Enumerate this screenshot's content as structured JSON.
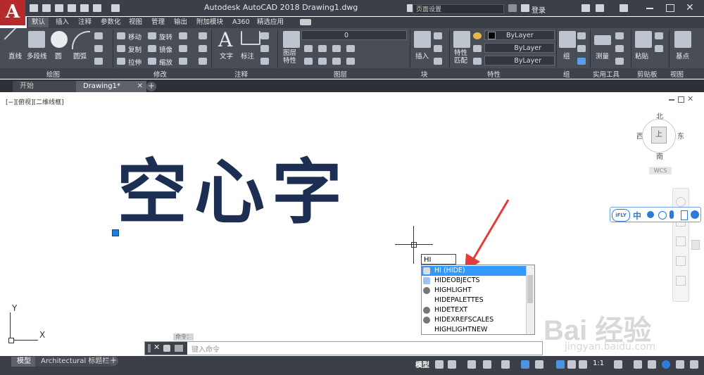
{
  "app": {
    "logo_letter": "A",
    "title": "Autodesk AutoCAD 2018    Drawing1.dwg",
    "search_placeholder": "页面设置",
    "login": "登录"
  },
  "ribbon_tabs": [
    "默认",
    "插入",
    "注释",
    "参数化",
    "视图",
    "管理",
    "输出",
    "附加模块",
    "A360",
    "精选应用"
  ],
  "ribbon": {
    "draw": {
      "line": "直线",
      "polyline": "多段线",
      "circle": "圆",
      "arc": "圆弧"
    },
    "modify": {
      "move": "移动",
      "rotate": "旋转",
      "copy": "复制",
      "mirror": "镜像",
      "stretch": "拉伸",
      "scale": "缩放"
    },
    "annotation": {
      "text": "文字",
      "dimension": "标注"
    },
    "layers": {
      "layer_props": "图层\n特性",
      "current_layer": "0"
    },
    "block": {
      "insert": "插入"
    },
    "properties": {
      "match": "特性\n匹配",
      "color": "ByLayer",
      "linetype": "ByLayer",
      "lineweight": "ByLayer"
    },
    "groups": {
      "group": "组"
    },
    "utilities": {
      "measure": "测量"
    },
    "clipboard": {
      "paste": "粘贴"
    },
    "view": {
      "base": "基点"
    }
  },
  "panel_labels": [
    "绘图",
    "修改",
    "注释",
    "图层",
    "块",
    "特性",
    "组",
    "实用工具",
    "剪贴板",
    "视图"
  ],
  "file_tabs": {
    "start": "开始",
    "drawing": "Drawing1*"
  },
  "viewport": {
    "label": "[−][俯视][二维线框]",
    "big_text": "空心字",
    "compass": {
      "north": "北",
      "south": "南",
      "east": "东",
      "west": "西",
      "top": "上"
    },
    "wcs": "WCS",
    "axis_x": "X",
    "axis_y": "Y"
  },
  "command": {
    "typed": "HI",
    "autocomplete": [
      "HI (HIDE)",
      "HIDEOBJECTS",
      "HIGHLIGHT",
      "HIDEPALETTES",
      "HIDETEXT",
      "HIDEXREFSCALES",
      "HIGHLIGHTNEW"
    ],
    "prompt": "键入命令",
    "label": "命令："
  },
  "status": {
    "tabs": [
      "模型",
      "Architectural 标题栏"
    ],
    "model": "模型",
    "scale": "1:1"
  },
  "ifly": {
    "logo": "iFLY",
    "lang": "中"
  },
  "watermark": {
    "brand": "Bai 经验",
    "url": "jingyan.baidu.com"
  },
  "colors": {
    "accent": "#3399ff",
    "ribbon_bg": "#494e56",
    "text_fill": "#1c2e52",
    "logo_red": "#b52a2a",
    "arrow": "#e53a3a"
  }
}
